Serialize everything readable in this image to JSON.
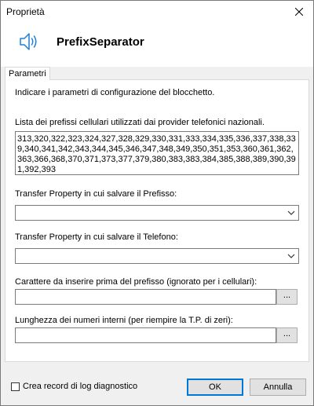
{
  "window": {
    "title": "Proprietà"
  },
  "header": {
    "icon": "speaker-icon",
    "title": "PrefixSeparator"
  },
  "tabs": [
    {
      "label": "Parametri",
      "selected": true
    }
  ],
  "panel": {
    "intro": "Indicare i parametri di configurazione del blocchetto.",
    "prefix_list": {
      "label": "Lista dei prefissi cellulari utilizzati dai provider telefonici nazionali.",
      "value": "313,320,322,323,324,327,328,329,330,331,333,334,335,336,337,338,339,340,341,342,343,344,345,346,347,348,349,350,351,353,360,361,362,363,366,368,370,371,373,377,379,380,383,383,384,385,388,389,390,391,392,393"
    },
    "prefix_property": {
      "label": "Transfer Property in cui salvare il Prefisso:",
      "value": ""
    },
    "phone_property": {
      "label": "Transfer Property in cui salvare il Telefono:",
      "value": ""
    },
    "prefix_char": {
      "label": "Carattere da inserire prima del prefisso (ignorato per i cellulari):",
      "value": "",
      "browse_label": "..."
    },
    "internal_length": {
      "label": "Lunghezza dei numeri interni (per riempire la T.P. di zeri):",
      "value": "",
      "browse_label": "..."
    }
  },
  "footer": {
    "log_checkbox_label": "Crea record di log diagnostico",
    "log_checked": false,
    "ok_label": "OK",
    "cancel_label": "Annulla"
  },
  "colors": {
    "accent": "#0078d7",
    "speaker_icon": "#1e7fd6"
  }
}
